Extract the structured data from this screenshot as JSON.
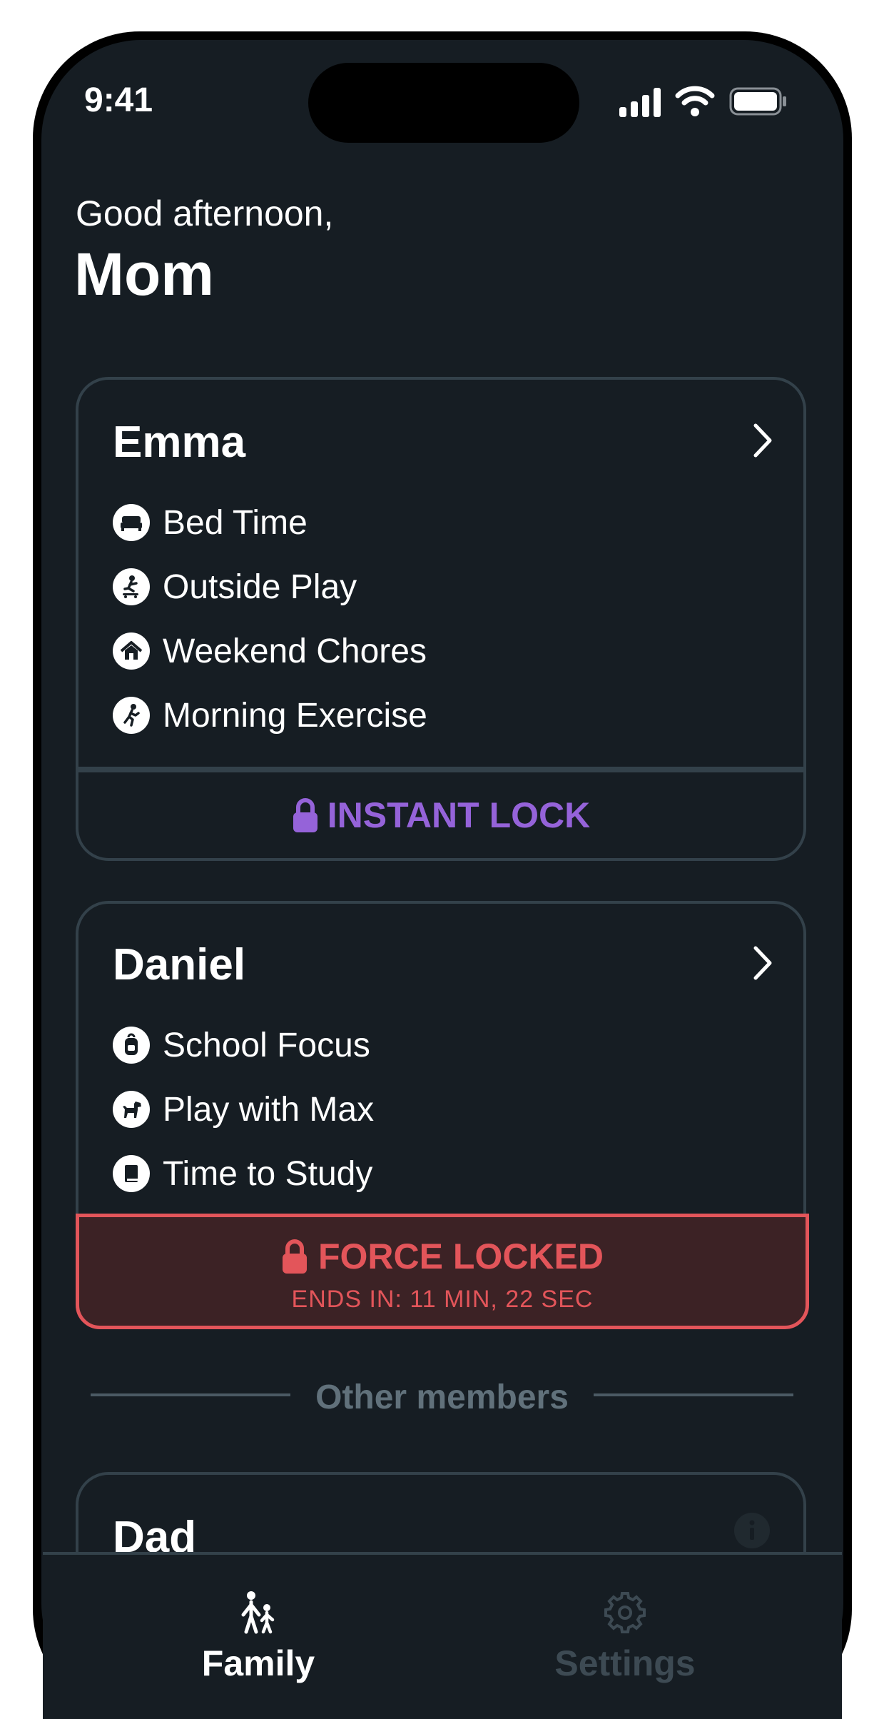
{
  "status_bar": {
    "time": "9:41"
  },
  "header": {
    "greeting": "Good afternoon,",
    "user": "Mom"
  },
  "members": [
    {
      "name": "Emma",
      "items": [
        {
          "label": "Bed Time",
          "icon": "bed-icon"
        },
        {
          "label": "Outside Play",
          "icon": "skateboard-icon"
        },
        {
          "label": "Weekend Chores",
          "icon": "house-icon"
        },
        {
          "label": "Morning Exercise",
          "icon": "running-icon"
        }
      ],
      "action": {
        "label": "INSTANT LOCK",
        "icon": "lock-icon",
        "color": "#9563d9"
      }
    },
    {
      "name": "Daniel",
      "items": [
        {
          "label": "School Focus",
          "icon": "backpack-icon"
        },
        {
          "label": "Play with Max",
          "icon": "dog-icon"
        },
        {
          "label": "Time to Study",
          "icon": "book-icon"
        }
      ],
      "status": {
        "label": "FORCE LOCKED",
        "subtitle": "ENDS IN: 11 MIN, 22 SEC",
        "color": "#e3555a"
      }
    }
  ],
  "other_members": {
    "label": "Other members",
    "items": [
      {
        "name": "Dad",
        "icon": "info-icon"
      }
    ]
  },
  "tabbar": {
    "tabs": [
      {
        "label": "Family",
        "icon": "family-icon",
        "active": true
      },
      {
        "label": "Settings",
        "icon": "gear-icon",
        "active": false
      }
    ]
  },
  "colors": {
    "background": "#161d23",
    "card_border": "#33414a",
    "accent_purple": "#9563d9",
    "alert_red": "#e3555a",
    "alert_bg": "#3c2225",
    "muted": "#61717b"
  }
}
